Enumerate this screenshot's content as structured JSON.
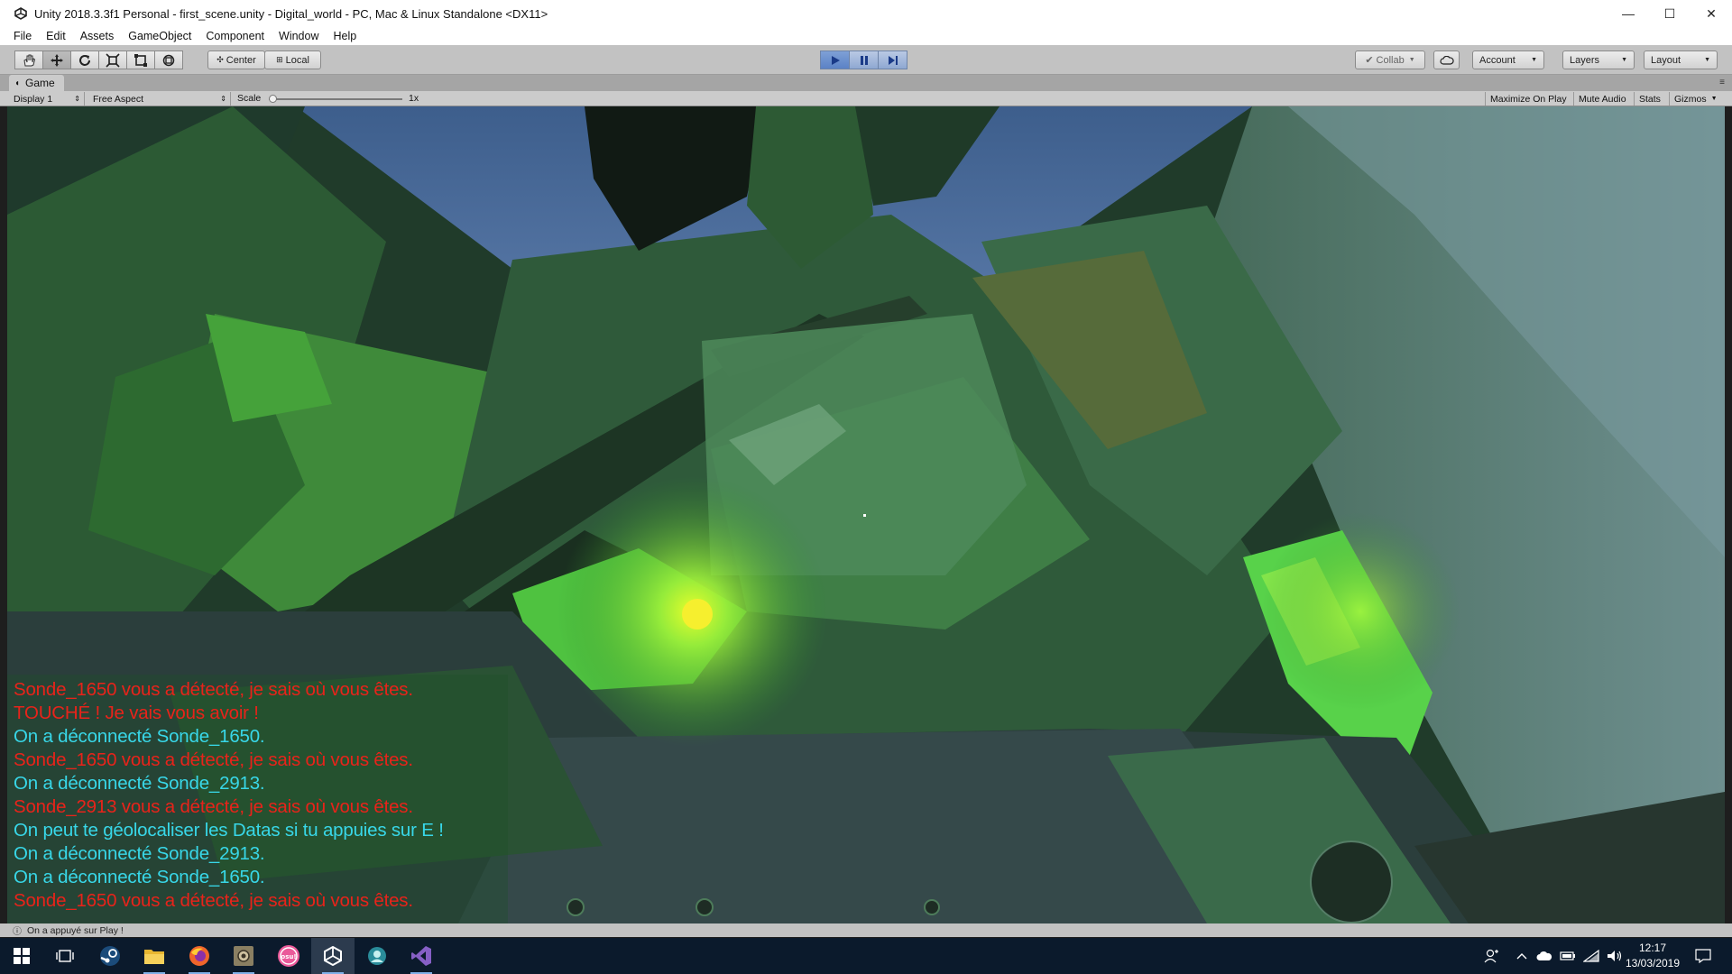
{
  "window": {
    "title": "Unity 2018.3.3f1 Personal - first_scene.unity - Digital_world - PC, Mac & Linux Standalone <DX11>",
    "minimize_glyph": "—",
    "maximize_glyph": "☐",
    "close_glyph": "✕"
  },
  "menu": [
    "File",
    "Edit",
    "Assets",
    "GameObject",
    "Component",
    "Window",
    "Help"
  ],
  "toolbar": {
    "tools": [
      "hand-tool-icon",
      "move-tool-icon",
      "rotate-tool-icon",
      "scale-tool-icon",
      "rect-tool-icon",
      "transform-tool-icon"
    ],
    "pivot_label": "Center",
    "space_label": "Local",
    "collab_label": "Collab",
    "account_label": "Account",
    "layers_label": "Layers",
    "layout_label": "Layout"
  },
  "game_tab": {
    "label": "Game",
    "display_label": "Display 1",
    "aspect_label": "Free Aspect",
    "scale_label": "Scale",
    "scale_value": "1x",
    "scale_fraction": 0,
    "toggles": [
      "Maximize On Play",
      "Mute Audio",
      "Stats",
      "Gizmos"
    ]
  },
  "console_messages": [
    {
      "text": "Sonde_1650 vous a détecté, je sais où vous êtes.",
      "color": "#e8231a"
    },
    {
      "text": "TOUCHÉ ! Je vais vous avoir !",
      "color": "#e8231a"
    },
    {
      "text": "On a déconnecté Sonde_1650.",
      "color": "#38d7e8"
    },
    {
      "text": "Sonde_1650 vous a détecté, je sais où vous êtes.",
      "color": "#e8231a"
    },
    {
      "text": "On a déconnecté Sonde_2913.",
      "color": "#38d7e8"
    },
    {
      "text": "Sonde_2913 vous a détecté, je sais où vous êtes.",
      "color": "#e8231a"
    },
    {
      "text": "On peut te géolocaliser les Datas si tu appuies sur E !",
      "color": "#38d7e8"
    },
    {
      "text": "On a déconnecté Sonde_2913.",
      "color": "#38d7e8"
    },
    {
      "text": "On a déconnecté Sonde_1650.",
      "color": "#38d7e8"
    },
    {
      "text": "Sonde_1650 vous a détecté, je sais où vous êtes.",
      "color": "#e8231a"
    }
  ],
  "status": {
    "message": "On a appuyé sur Play !"
  },
  "taskbar": {
    "apps": [
      "windows-start-icon",
      "task-view-icon",
      "steam-icon",
      "file-explorer-icon",
      "firefox-icon",
      "photo-app-icon",
      "osu-icon",
      "unity-icon",
      "app-blue-icon",
      "visual-studio-icon"
    ],
    "time": "12:17",
    "date": "13/03/2019"
  },
  "colors": {
    "unity_toolbar": "#c2c2c2",
    "play_active": "#5b82c6",
    "taskbar": "#0b1a2c",
    "console_red": "#e8231a",
    "console_cyan": "#38d7e8"
  }
}
